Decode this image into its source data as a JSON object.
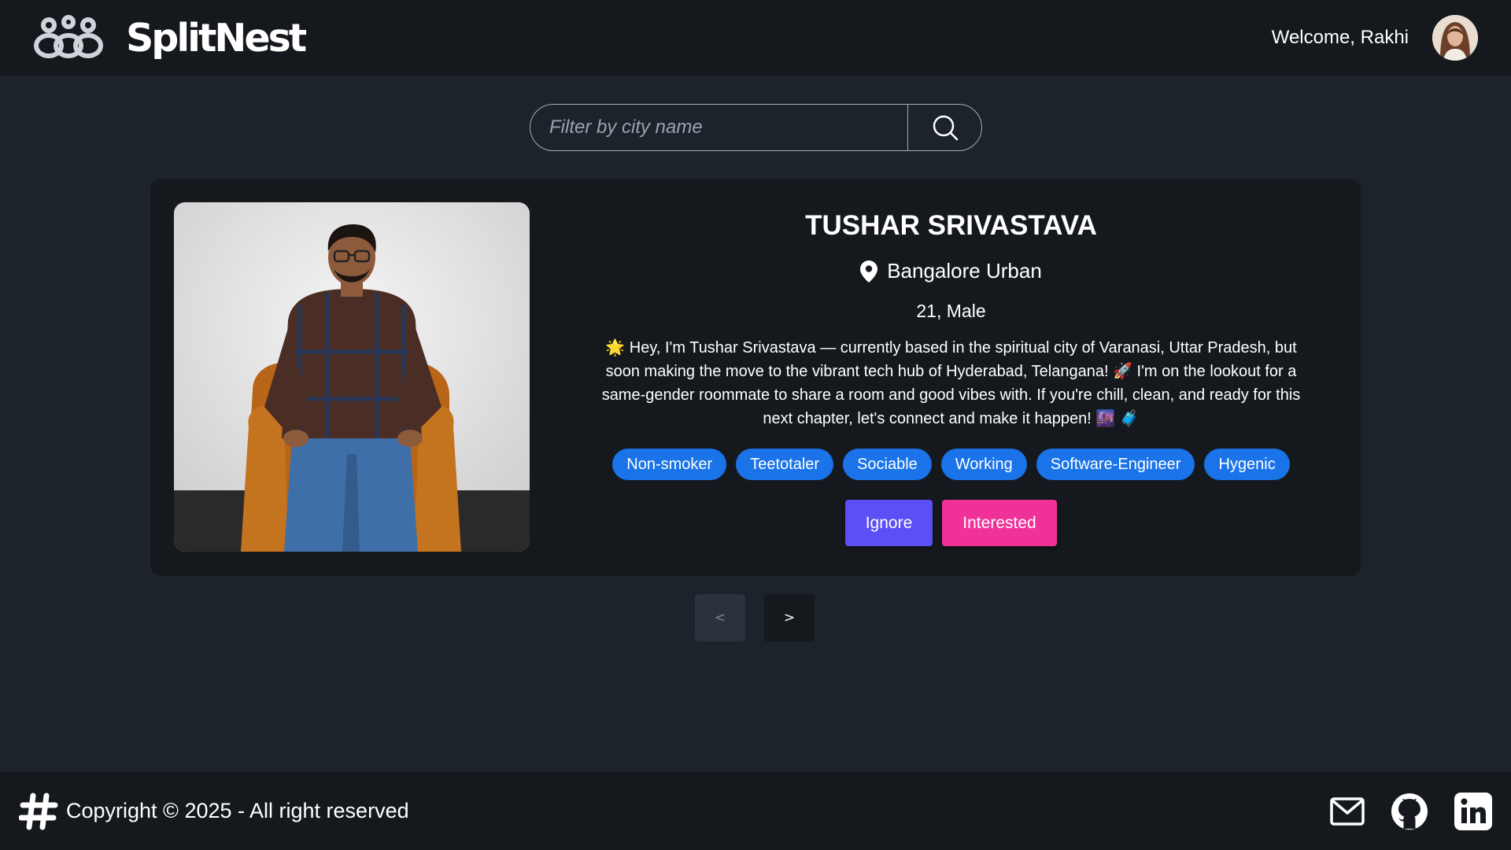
{
  "header": {
    "brand_name": "SplitNest",
    "welcome_text": "Welcome, Rakhi"
  },
  "search": {
    "placeholder": "Filter by city name",
    "value": ""
  },
  "profile": {
    "name": "TUSHAR SRIVASTAVA",
    "location": "Bangalore Urban",
    "age_gender": "21, Male",
    "bio": "🌟 Hey, I'm Tushar Srivastava — currently based in the spiritual city of Varanasi, Uttar Pradesh, but soon making the move to the vibrant tech hub of Hyderabad, Telangana! 🚀 I'm on the lookout for a same-gender roommate to share a room and good vibes with. If you're chill, clean, and ready for this next chapter, let's connect and make it happen! 🌆 🧳",
    "tags": [
      "Non-smoker",
      "Teetotaler",
      "Sociable",
      "Working",
      "Software-Engineer",
      "Hygenic"
    ]
  },
  "actions": {
    "ignore_label": "Ignore",
    "interested_label": "Interested"
  },
  "pagination": {
    "prev_label": "<",
    "next_label": ">"
  },
  "footer": {
    "copyright": "Copyright © 2025 - All right reserved"
  },
  "icons": {
    "logo": "interlinked-rings-logo",
    "search": "search-icon",
    "location": "map-pin-icon",
    "footer_logo": "hash-icon",
    "socials": [
      "mail-icon",
      "github-icon",
      "linkedin-icon"
    ]
  },
  "colors": {
    "background": "#1d232a",
    "surface": "#15191e",
    "tag": "#1a73e8",
    "ignore": "#5b4ff5",
    "interested": "#f0319a"
  }
}
